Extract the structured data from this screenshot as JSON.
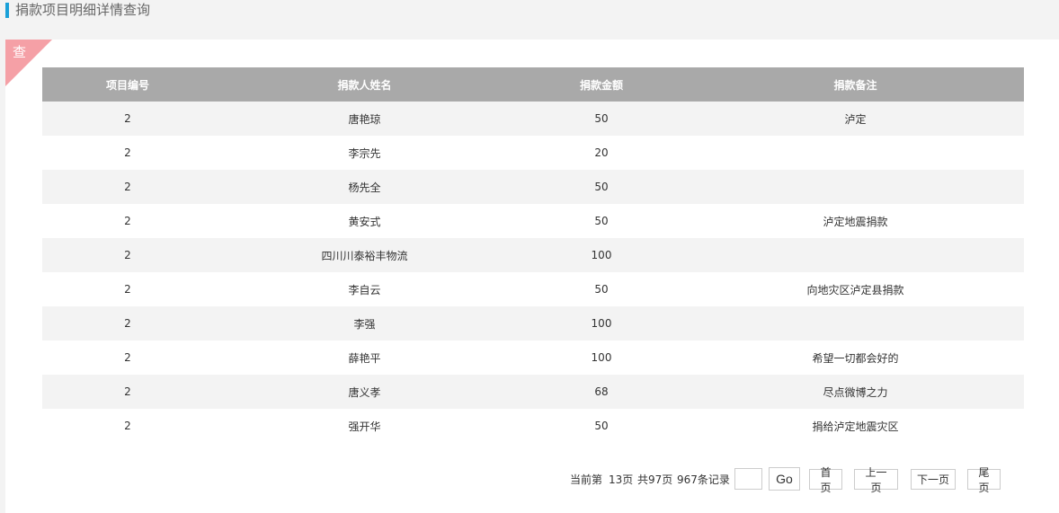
{
  "header": {
    "title": "捐款项目明细详情查询"
  },
  "panel": {
    "corner_label": "查"
  },
  "table": {
    "columns": [
      "项目编号",
      "捐款人姓名",
      "捐款金额",
      "捐款备注"
    ],
    "rows": [
      [
        "2",
        "唐艳琼",
        "50",
        "泸定"
      ],
      [
        "2",
        "李宗先",
        "20",
        ""
      ],
      [
        "2",
        "杨先全",
        "50",
        ""
      ],
      [
        "2",
        "黄安式",
        "50",
        "泸定地震捐款"
      ],
      [
        "2",
        "四川川泰裕丰物流",
        "100",
        ""
      ],
      [
        "2",
        "李自云",
        "50",
        "向地灾区泸定县捐款"
      ],
      [
        "2",
        "李强",
        "100",
        ""
      ],
      [
        "2",
        "薛艳平",
        "100",
        "希望一切都会好的"
      ],
      [
        "2",
        "唐义孝",
        "68",
        "尽点微博之力"
      ],
      [
        "2",
        "强开华",
        "50",
        "捐给泸定地震灾区"
      ]
    ]
  },
  "pager": {
    "current_prefix": "当前第",
    "current_page": "13页",
    "total_pages": "共97页",
    "total_records": "967条记录",
    "page_input_value": "",
    "go_label": "Go",
    "first_label": "首页",
    "prev_label": "上一页",
    "next_label": "下一页",
    "last_label": "尾页"
  },
  "colors": {
    "accent": "#1aa0d8",
    "ribbon": "#f5a0a6",
    "table_header": "#a9a9a9"
  }
}
